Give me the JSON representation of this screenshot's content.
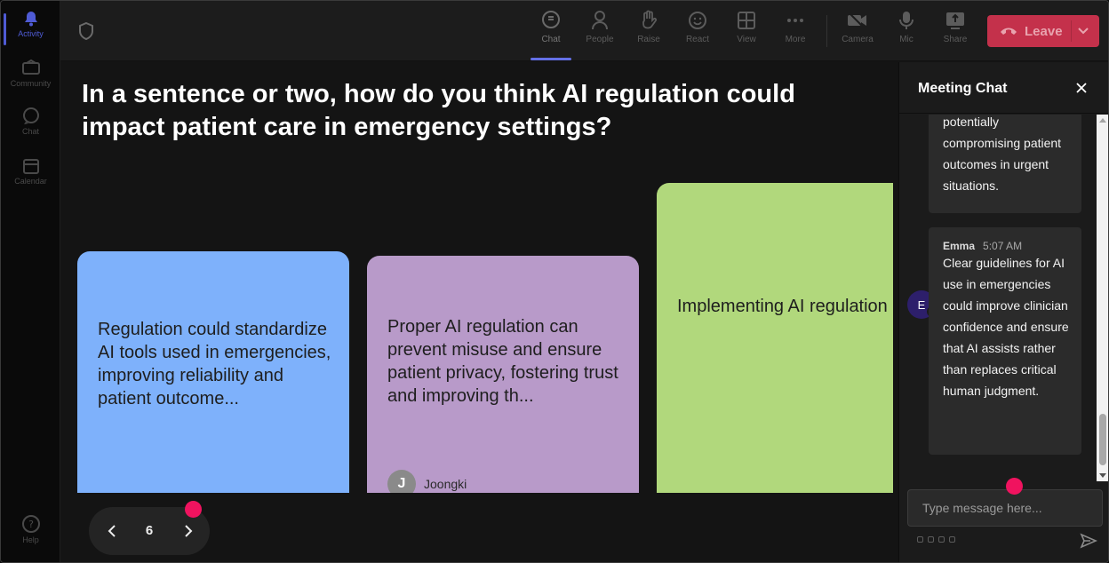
{
  "rail": {
    "items": [
      {
        "label": "Activity",
        "icon": "bell-icon"
      },
      {
        "label": "Community",
        "icon": "community-icon"
      },
      {
        "label": "Chat",
        "icon": "chat-icon"
      },
      {
        "label": "Calendar",
        "icon": "calendar-icon"
      },
      {
        "label": "Help",
        "icon": "help-icon"
      }
    ]
  },
  "toolbar": {
    "chat": "Chat",
    "people": "People",
    "raise": "Raise",
    "react": "React",
    "view": "View",
    "more": "More",
    "camera": "Camera",
    "mic": "Mic",
    "share": "Share",
    "leave": "Leave"
  },
  "stage": {
    "question": "In a sentence or two, how do you think AI regulation could impact patient care in emergency settings?",
    "cards": [
      {
        "text": "Regulation could standardize AI tools used in emergencies, improving reliability and patient outcome...",
        "color": "#7eb1fb"
      },
      {
        "text": "Proper AI regulation can prevent misuse and ensure patient privacy, fostering trust and improving th...",
        "color": "#b89ac9",
        "author_initial": "J",
        "author_name": "Joongki"
      },
      {
        "text": "Implementing AI regulation emergency care could ensure safer and more ethical use of technology, ...",
        "color": "#b1d87c"
      }
    ],
    "page": "6"
  },
  "chat": {
    "title": "Meeting Chat",
    "messages": [
      {
        "body": "potentially compromising patient outcomes in urgent situations."
      },
      {
        "avatar": "E",
        "author": "Emma",
        "time": "5:07 AM",
        "body": "Clear guidelines for AI use in emergencies could improve clinician confidence and ensure that AI assists rather than replaces critical human judgment."
      }
    ],
    "placeholder": "Type message here..."
  },
  "colors": {
    "accent": "#6470e6",
    "leave": "#c4314b",
    "marker": "#f0135f"
  }
}
